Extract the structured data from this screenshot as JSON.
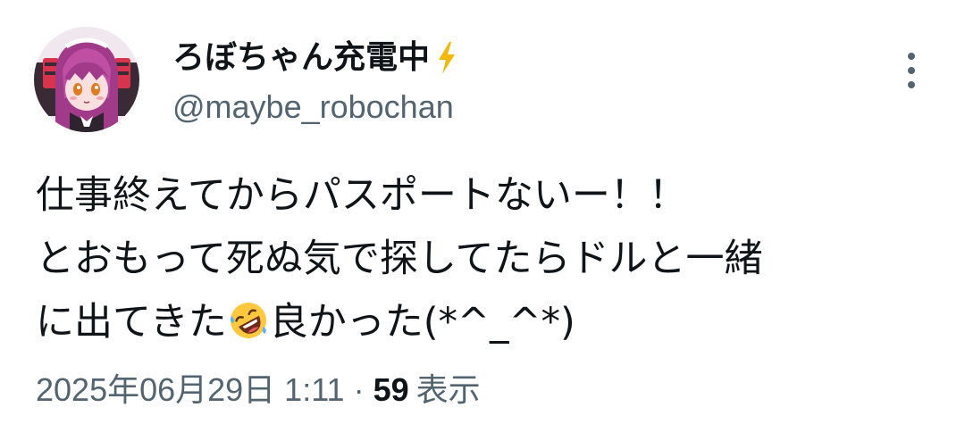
{
  "author": {
    "display_name": "ろぼちゃん充電中",
    "badge_icon": "lightning-bolt-icon",
    "handle": "@maybe_robochan"
  },
  "tweet": {
    "lines": [
      {
        "text": "仕事終えてからパスポートないー！！"
      },
      {
        "text": "とおもって死ぬ気で探してたらドルと一緒"
      },
      {
        "before_emoji": "に出てきた",
        "emoji_icon": "rolling-on-floor-laughing-icon",
        "after_emoji": "良かった(*^_^*)"
      }
    ]
  },
  "meta": {
    "timestamp": "2025年06月29日 1:11",
    "separator": "·",
    "views_count": "59",
    "views_label": "表示"
  },
  "colors": {
    "text_primary": "#0f1419",
    "text_secondary": "#536471",
    "bolt": "#f5b800"
  }
}
